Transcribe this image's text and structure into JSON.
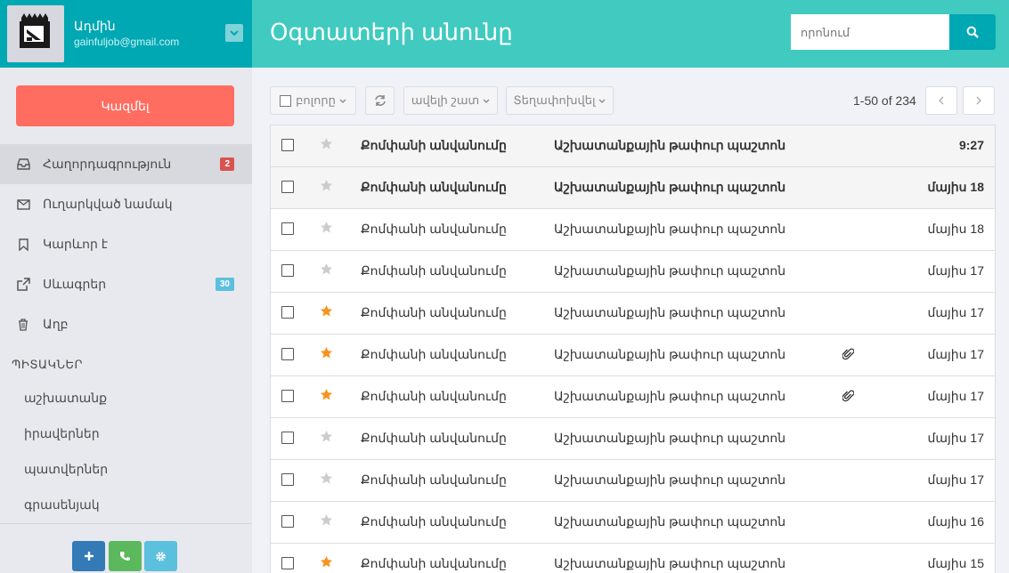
{
  "user": {
    "name": "Ադմին",
    "email": "gainfuljob@gmail.com"
  },
  "sidebar": {
    "compose_label": "Կազմել",
    "items": [
      {
        "label": "Հաղորդագրություն",
        "icon": "inbox-icon",
        "badge": "2"
      },
      {
        "label": "Ուղարկված նամակ",
        "icon": "envelope-icon",
        "badge": ""
      },
      {
        "label": "Կարևոր է",
        "icon": "bookmark-icon",
        "badge": ""
      },
      {
        "label": "Սևագրեր",
        "icon": "external-link-icon",
        "badge": "30"
      },
      {
        "label": "Աղբ",
        "icon": "trash-icon",
        "badge": ""
      }
    ],
    "labels_title": "ՊԻՏԱԿՆԵՐ",
    "labels": [
      "աշխատանք",
      "իրավերներ",
      "պատվերներ",
      "գրասենյակ"
    ],
    "bottom_buttons": [
      {
        "icon": "plus-icon",
        "color": "#337ab7"
      },
      {
        "icon": "phone-icon",
        "color": "#5cb85c"
      },
      {
        "icon": "gear-icon",
        "color": "#5bc0de"
      }
    ]
  },
  "header": {
    "title": "Օգտատերի անունը",
    "search_placeholder": "որոնում"
  },
  "toolbar": {
    "select_label": "բոլորը",
    "more_label": "ավելի շատ",
    "move_label": "Տեղափոխվել",
    "pager_text": "1-50 of 234"
  },
  "colors": {
    "accent": "#41cac0",
    "dark_accent": "#00a8b3",
    "compose": "#ff6c60",
    "star_active": "#f7931e",
    "star_inactive": "#cccccc"
  },
  "emails": [
    {
      "sender": "Քոմփանի անվանումը",
      "subject": "Աշխատանքային թափուր պաշտոն",
      "date": "9:27",
      "starred": false,
      "unread": true,
      "attachment": false
    },
    {
      "sender": "Քոմփանի անվանումը",
      "subject": "Աշխատանքային թափուր պաշտոն",
      "date": "մայիս 18",
      "starred": false,
      "unread": true,
      "attachment": false
    },
    {
      "sender": "Քոմփանի անվանումը",
      "subject": "Աշխատանքային թափուր պաշտոն",
      "date": "մայիս 18",
      "starred": false,
      "unread": false,
      "attachment": false
    },
    {
      "sender": "Քոմփանի անվանումը",
      "subject": "Աշխատանքային թափուր պաշտոն",
      "date": "մայիս 17",
      "starred": false,
      "unread": false,
      "attachment": false
    },
    {
      "sender": "Քոմփանի անվանումը",
      "subject": "Աշխատանքային թափուր պաշտոն",
      "date": "մայիս 17",
      "starred": true,
      "unread": false,
      "attachment": false
    },
    {
      "sender": "Քոմփանի անվանումը",
      "subject": "Աշխատանքային թափուր պաշտոն",
      "date": "մայիս 17",
      "starred": true,
      "unread": false,
      "attachment": true
    },
    {
      "sender": "Քոմփանի անվանումը",
      "subject": "Աշխատանքային թափուր պաշտոն",
      "date": "մայիս 17",
      "starred": true,
      "unread": false,
      "attachment": true
    },
    {
      "sender": "Քոմփանի անվանումը",
      "subject": "Աշխատանքային թափուր պաշտոն",
      "date": "մայիս 17",
      "starred": false,
      "unread": false,
      "attachment": false
    },
    {
      "sender": "Քոմփանի անվանումը",
      "subject": "Աշխատանքային թափուր պաշտոն",
      "date": "մայիս 17",
      "starred": false,
      "unread": false,
      "attachment": false
    },
    {
      "sender": "Քոմփանի անվանումը",
      "subject": "Աշխատանքային թափուր պաշտոն",
      "date": "մայիս 16",
      "starred": false,
      "unread": false,
      "attachment": false
    },
    {
      "sender": "Քոմփանի անվանումը",
      "subject": "Աշխատանքային թափուր պաշտոն",
      "date": "մայիս 15",
      "starred": true,
      "unread": false,
      "attachment": false
    }
  ]
}
